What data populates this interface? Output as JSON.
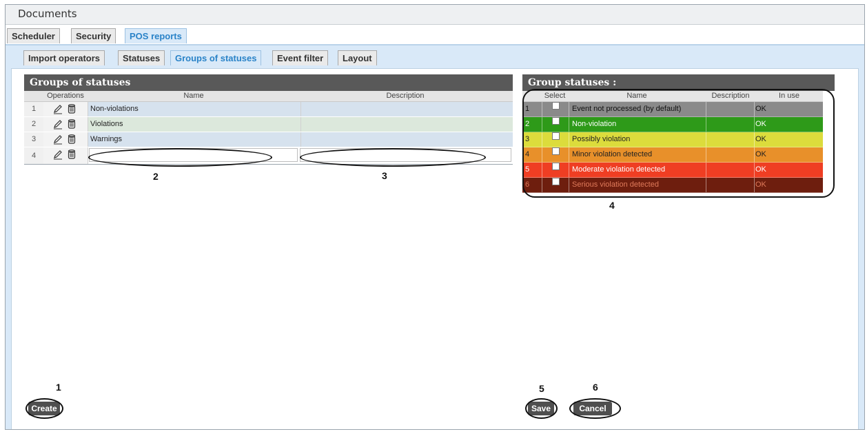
{
  "window": {
    "title": "Documents"
  },
  "main_tabs": [
    {
      "label": "Scheduler"
    },
    {
      "label": "Security"
    },
    {
      "label": "POS reports",
      "active": true
    }
  ],
  "sub_tabs": [
    {
      "label": "Import operators"
    },
    {
      "label": "Statuses"
    },
    {
      "label": "Groups of statuses",
      "active": true
    },
    {
      "label": "Event filter"
    },
    {
      "label": "Layout"
    }
  ],
  "groups_panel": {
    "title": "Groups of statuses",
    "columns": {
      "operations": "Operations",
      "name": "Name",
      "description": "Description"
    },
    "rows": [
      {
        "num": "1",
        "name": "Non-violations",
        "description": ""
      },
      {
        "num": "2",
        "name": "Violations",
        "description": ""
      },
      {
        "num": "3",
        "name": "Warnings",
        "description": ""
      },
      {
        "num": "4",
        "name": "",
        "description": "",
        "editing": true
      }
    ],
    "create_label": "Create"
  },
  "statuses_panel": {
    "title": "Group statuses :",
    "columns": {
      "select": "Select",
      "name": "Name",
      "description": "Description",
      "in_use": "In use"
    },
    "rows": [
      {
        "num": "1",
        "name": "Event not processed (by default)",
        "in_use": "OK",
        "color": "#8a8a8a",
        "text_color": "#111111"
      },
      {
        "num": "2",
        "name": "Non-violation",
        "in_use": "OK",
        "color": "#2e9a19",
        "text_color": "#ffffff"
      },
      {
        "num": "3",
        "name": "Possibly violation",
        "in_use": "OK",
        "color": "#dcdc3c",
        "text_color": "#222222"
      },
      {
        "num": "4",
        "name": "Minor violation detected",
        "in_use": "OK",
        "color": "#e8902a",
        "text_color": "#222222"
      },
      {
        "num": "5",
        "name": "Moderate violation detected",
        "in_use": "OK",
        "color": "#ef3e23",
        "text_color": "#ffffff"
      },
      {
        "num": "6",
        "name": "Serious violation detected",
        "in_use": "OK",
        "color": "#6e1e0e",
        "text_color": "#e07a5a"
      }
    ],
    "save_label": "Save",
    "cancel_label": "Cancel"
  },
  "callouts": [
    "1",
    "2",
    "3",
    "4",
    "5",
    "6"
  ],
  "colors": {
    "header": "#595959",
    "accent": "#2a83c8",
    "tab_strip": "#d9e9f8"
  }
}
